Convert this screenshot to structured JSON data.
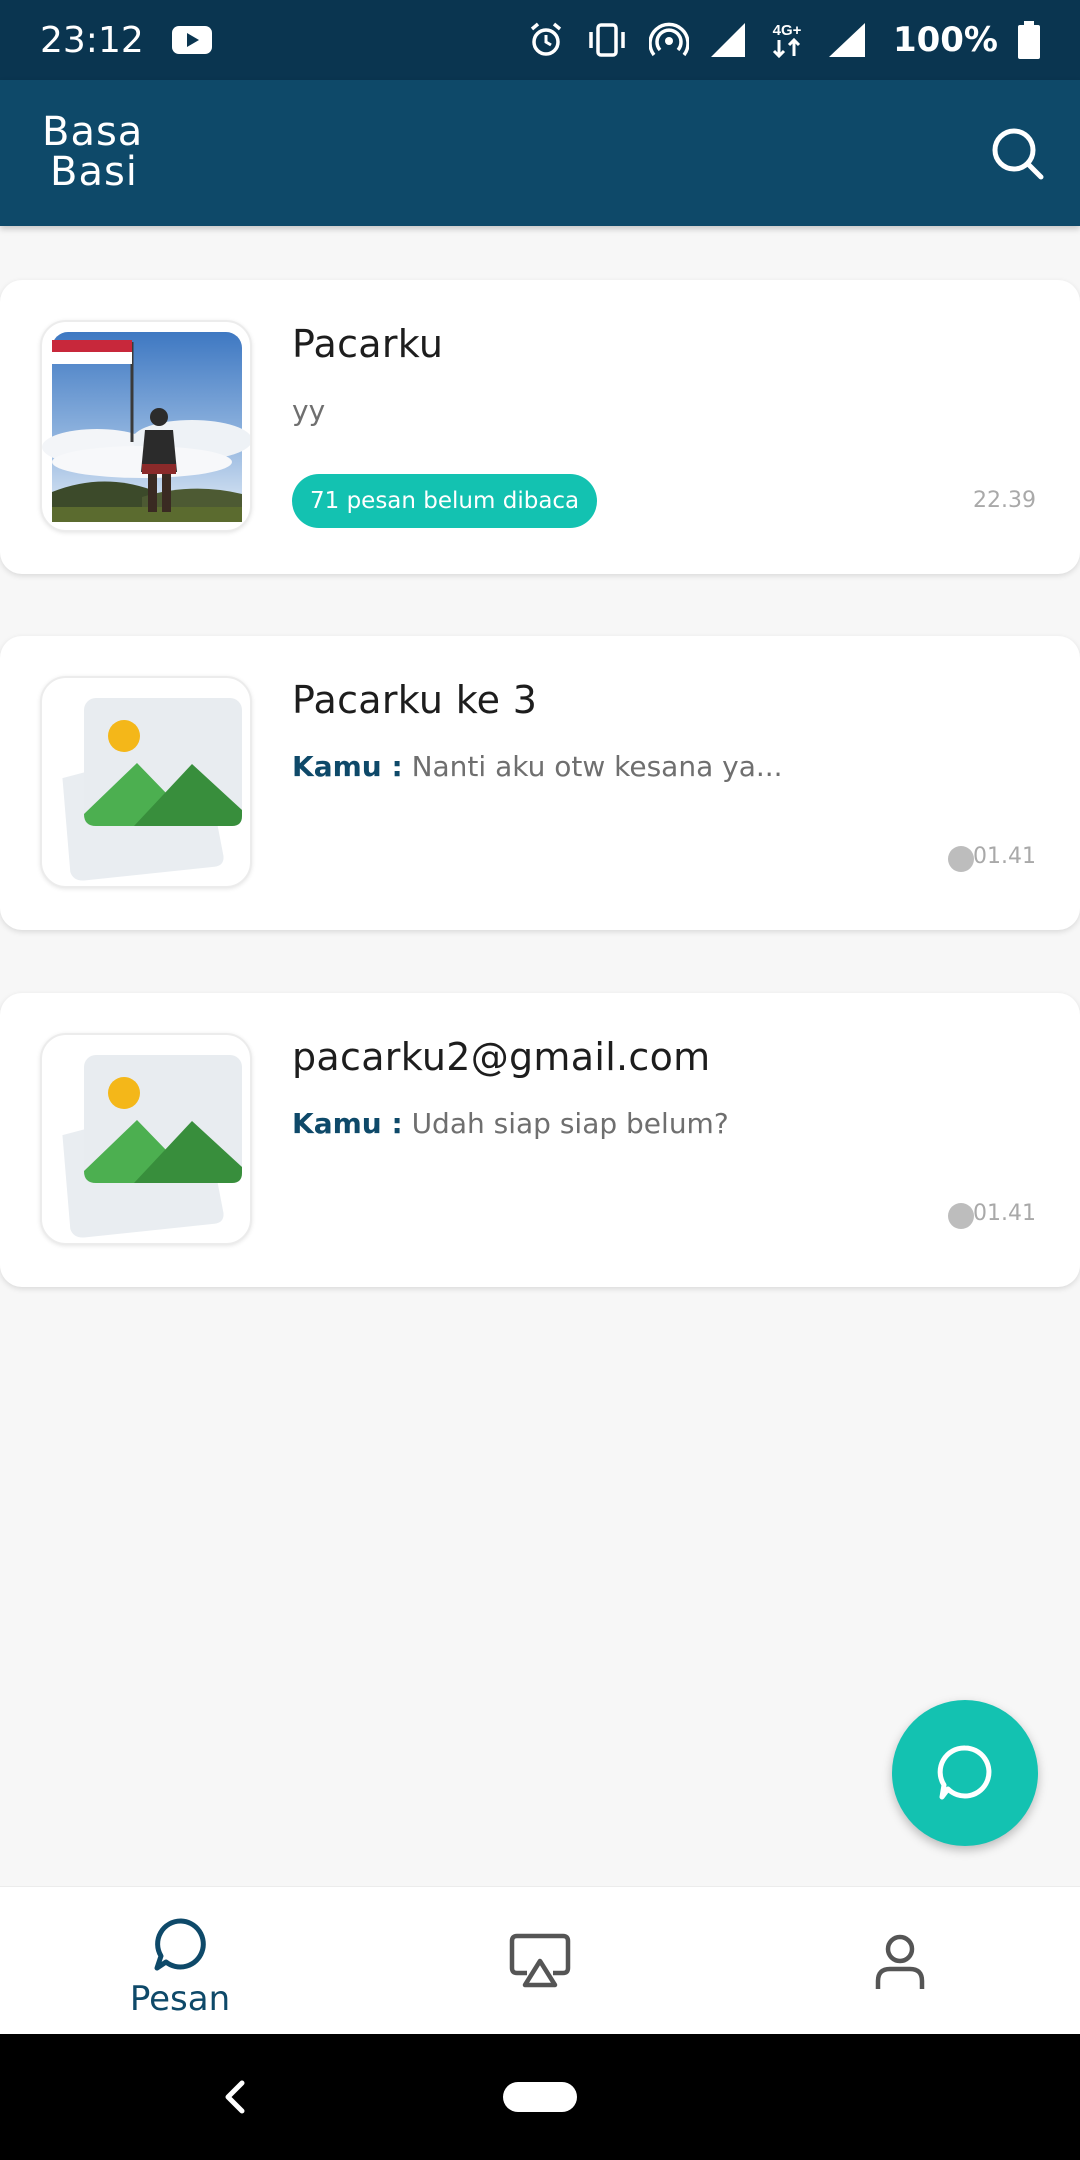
{
  "status_bar": {
    "time": "23:12",
    "battery": "100%",
    "network": "4G+",
    "icons": [
      "youtube-icon",
      "alarm-icon",
      "vibrate-icon",
      "hotspot-icon",
      "signal-icon",
      "network-4g-icon",
      "signal-icon",
      "battery-icon"
    ]
  },
  "app_bar": {
    "logo_line1": "Basa",
    "logo_line2": "Basi",
    "search_icon": "search-icon"
  },
  "chats": [
    {
      "name": "Pacarku",
      "preview": "yy",
      "unread": "71 pesan belum dibaca",
      "time": "22.39",
      "avatar": "photo"
    },
    {
      "name": "Pacarku ke 3",
      "sender": "Kamu :",
      "preview": "Nanti aku otw kesana ya...",
      "time": "01.41",
      "avatar": "placeholder-image-icon"
    },
    {
      "name": "pacarku2@gmail.com",
      "sender": "Kamu :",
      "preview": "Udah siap siap belum?",
      "time": "01.41",
      "avatar": "placeholder-image-icon"
    }
  ],
  "fab": {
    "icon": "new-chat-icon"
  },
  "bottom_nav": {
    "items": [
      {
        "label": "Pesan",
        "icon": "chat-bubble-icon",
        "active": true
      },
      {
        "label": "",
        "icon": "story-cast-icon",
        "active": false
      },
      {
        "label": "",
        "icon": "profile-icon",
        "active": false
      }
    ]
  },
  "colors": {
    "status_bar": "#0a3550",
    "app_bar": "#0e4969",
    "accent": "#13c2b1",
    "text_primary": "#1d1d1d",
    "dot": "#bdbdbd"
  }
}
